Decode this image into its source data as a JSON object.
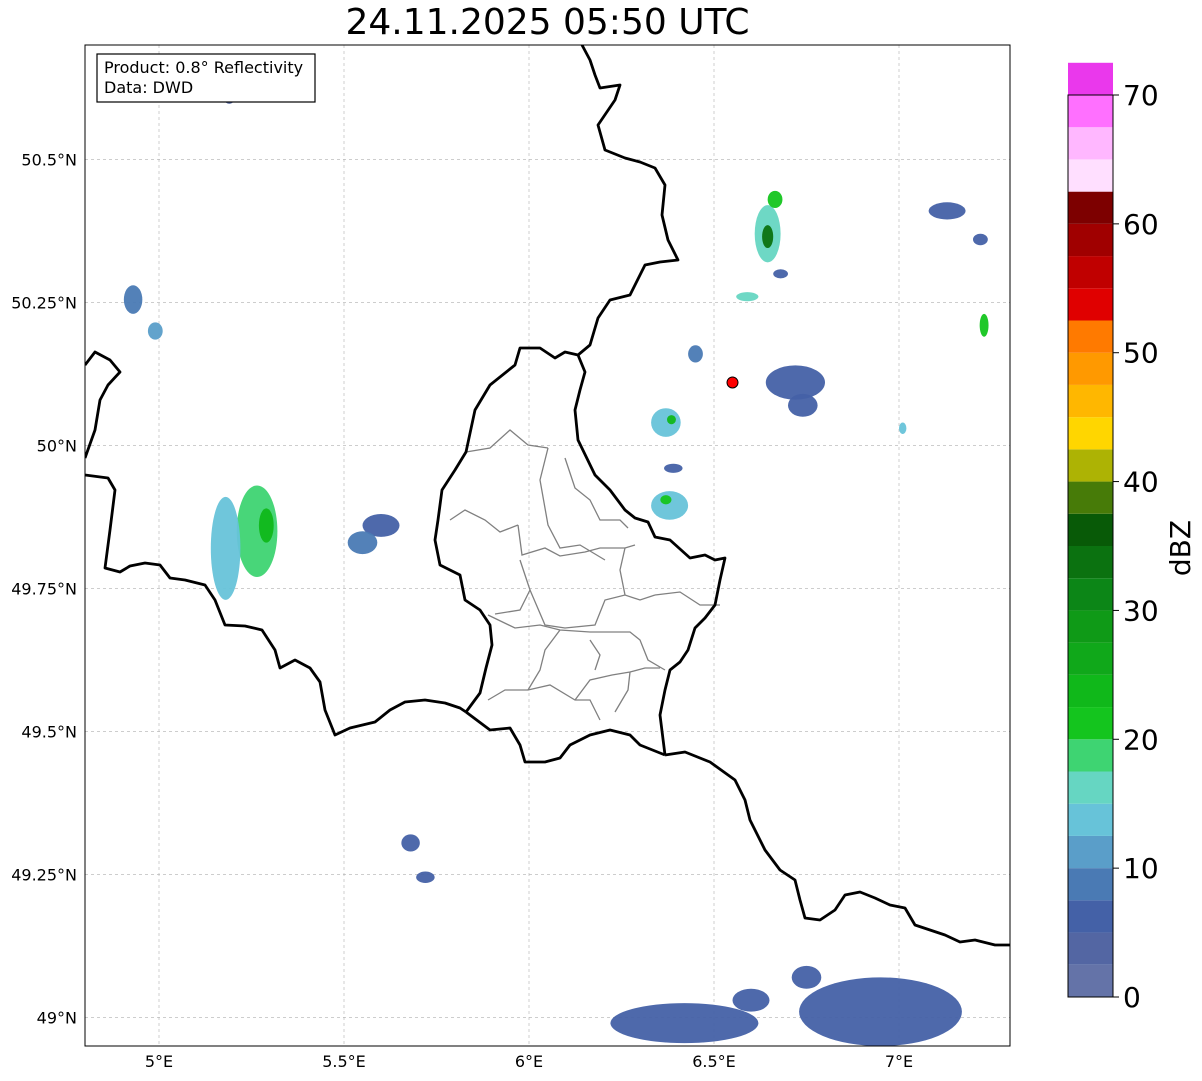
{
  "title": "24.11.2025 05:50 UTC",
  "info_box": {
    "product": "Product: 0.8° Reflectivity",
    "source": "Data: DWD"
  },
  "map": {
    "lon_range": [
      4.8,
      7.3
    ],
    "lat_range": [
      48.95,
      50.7
    ],
    "lon_ticks": [
      {
        "value": 5.0,
        "label": "5°E"
      },
      {
        "value": 5.5,
        "label": "5.5°E"
      },
      {
        "value": 6.0,
        "label": "6°E"
      },
      {
        "value": 6.5,
        "label": "6.5°E"
      },
      {
        "value": 7.0,
        "label": "7°E"
      }
    ],
    "lat_ticks": [
      {
        "value": 49.0,
        "label": "49°N"
      },
      {
        "value": 49.25,
        "label": "49.25°N"
      },
      {
        "value": 49.5,
        "label": "49.5°N"
      },
      {
        "value": 49.75,
        "label": "49.75°N"
      },
      {
        "value": 50.0,
        "label": "50°N"
      },
      {
        "value": 50.25,
        "label": "50.25°N"
      },
      {
        "value": 50.5,
        "label": "50.5°N"
      }
    ],
    "grid": true,
    "radar_site": {
      "lon": 6.55,
      "lat": 50.11,
      "color": "#ff0000"
    },
    "colors": {
      "border": "#000000",
      "admin": "#808080",
      "grid": "#b0b0b0"
    }
  },
  "echoes": [
    {
      "lon": 5.265,
      "lat": 49.85,
      "rlon": 0.055,
      "rlat": 0.08,
      "dbz": 19
    },
    {
      "lon": 5.18,
      "lat": 49.82,
      "rlon": 0.04,
      "rlat": 0.09,
      "dbz": 13
    },
    {
      "lon": 5.29,
      "lat": 49.86,
      "rlon": 0.02,
      "rlat": 0.03,
      "dbz": 24
    },
    {
      "lon": 5.6,
      "lat": 49.86,
      "rlon": 0.05,
      "rlat": 0.02,
      "dbz": 6
    },
    {
      "lon": 5.55,
      "lat": 49.83,
      "rlon": 0.04,
      "rlat": 0.02,
      "dbz": 8
    },
    {
      "lon": 4.93,
      "lat": 50.255,
      "rlon": 0.025,
      "rlat": 0.025,
      "dbz": 9
    },
    {
      "lon": 4.99,
      "lat": 50.2,
      "rlon": 0.02,
      "rlat": 0.015,
      "dbz": 11
    },
    {
      "lon": 6.645,
      "lat": 50.37,
      "rlon": 0.035,
      "rlat": 0.05,
      "dbz": 16
    },
    {
      "lon": 6.645,
      "lat": 50.365,
      "rlon": 0.015,
      "rlat": 0.02,
      "dbz": 33
    },
    {
      "lon": 6.665,
      "lat": 50.43,
      "rlon": 0.02,
      "rlat": 0.015,
      "dbz": 22
    },
    {
      "lon": 6.68,
      "lat": 50.3,
      "rlon": 0.02,
      "rlat": 0.008,
      "dbz": 7
    },
    {
      "lon": 6.37,
      "lat": 50.04,
      "rlon": 0.04,
      "rlat": 0.025,
      "dbz": 13
    },
    {
      "lon": 6.385,
      "lat": 50.045,
      "rlon": 0.012,
      "rlat": 0.008,
      "dbz": 24
    },
    {
      "lon": 6.38,
      "lat": 49.895,
      "rlon": 0.05,
      "rlat": 0.025,
      "dbz": 14
    },
    {
      "lon": 6.37,
      "lat": 49.905,
      "rlon": 0.015,
      "rlat": 0.008,
      "dbz": 22
    },
    {
      "lon": 6.39,
      "lat": 49.96,
      "rlon": 0.025,
      "rlat": 0.008,
      "dbz": 6
    },
    {
      "lon": 6.45,
      "lat": 50.16,
      "rlon": 0.02,
      "rlat": 0.015,
      "dbz": 8
    },
    {
      "lon": 6.59,
      "lat": 50.26,
      "rlon": 0.03,
      "rlat": 0.008,
      "dbz": 17
    },
    {
      "lon": 6.72,
      "lat": 50.11,
      "rlon": 0.08,
      "rlat": 0.03,
      "dbz": 5
    },
    {
      "lon": 6.74,
      "lat": 50.07,
      "rlon": 0.04,
      "rlat": 0.02,
      "dbz": 6
    },
    {
      "lon": 7.01,
      "lat": 50.03,
      "rlon": 0.01,
      "rlat": 0.01,
      "dbz": 14
    },
    {
      "lon": 7.23,
      "lat": 50.21,
      "rlon": 0.012,
      "rlat": 0.02,
      "dbz": 20
    },
    {
      "lon": 7.13,
      "lat": 50.41,
      "rlon": 0.05,
      "rlat": 0.015,
      "dbz": 6
    },
    {
      "lon": 7.22,
      "lat": 50.36,
      "rlon": 0.02,
      "rlat": 0.01,
      "dbz": 5
    },
    {
      "lon": 5.68,
      "lat": 49.305,
      "rlon": 0.025,
      "rlat": 0.015,
      "dbz": 7
    },
    {
      "lon": 5.72,
      "lat": 49.245,
      "rlon": 0.025,
      "rlat": 0.01,
      "dbz": 7
    },
    {
      "lon": 5.19,
      "lat": 50.605,
      "rlon": 0.012,
      "rlat": 0.008,
      "dbz": 4
    },
    {
      "lon": 6.42,
      "lat": 48.99,
      "rlon": 0.2,
      "rlat": 0.035,
      "dbz": 6
    },
    {
      "lon": 6.95,
      "lat": 49.01,
      "rlon": 0.22,
      "rlat": 0.06,
      "dbz": 7
    },
    {
      "lon": 6.75,
      "lat": 49.07,
      "rlon": 0.04,
      "rlat": 0.02,
      "dbz": 5
    },
    {
      "lon": 6.6,
      "lat": 49.03,
      "rlon": 0.05,
      "rlat": 0.02,
      "dbz": 6
    }
  ],
  "colorbar": {
    "label": "dBZ",
    "range": [
      0,
      70
    ],
    "step": 2.5,
    "tick_labels": [
      {
        "value": 0,
        "label": "0"
      },
      {
        "value": 10,
        "label": "10"
      },
      {
        "value": 20,
        "label": "20"
      },
      {
        "value": 30,
        "label": "30"
      },
      {
        "value": 40,
        "label": "40"
      },
      {
        "value": 50,
        "label": "50"
      },
      {
        "value": 60,
        "label": "60"
      },
      {
        "value": 70,
        "label": "70"
      }
    ],
    "colors": [
      "#6473a8",
      "#5366a3",
      "#4461a7",
      "#4a7ab4",
      "#5a9ec9",
      "#67c3d9",
      "#66d6c2",
      "#3ed472",
      "#14c51e",
      "#10b81a",
      "#10a81a",
      "#0f9a17",
      "#0c8617",
      "#0b7210",
      "#085a07",
      "#477b08",
      "#adb304",
      "#ffd600",
      "#ffb700",
      "#ff9900",
      "#ff7a00",
      "#e00000",
      "#c00000",
      "#a00000",
      "#7d0000",
      "#ffdfff",
      "#ffb7ff",
      "#ff70ff",
      "#ea38ec"
    ]
  }
}
